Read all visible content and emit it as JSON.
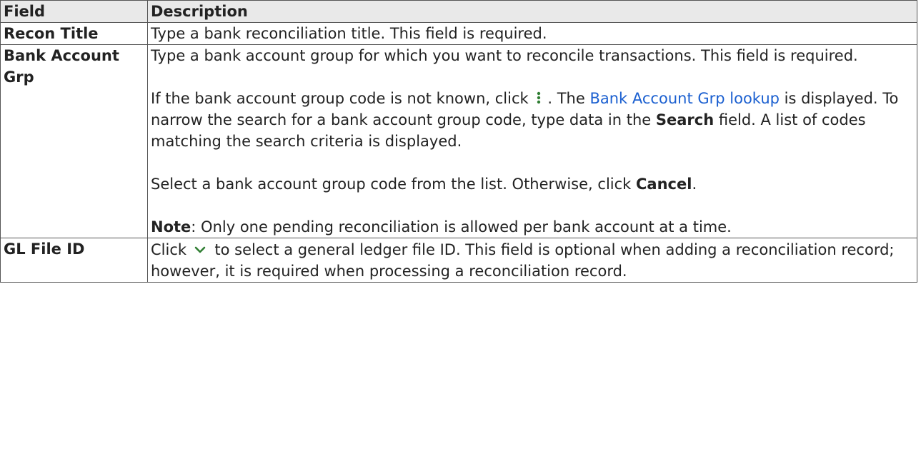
{
  "table": {
    "headers": [
      "Field",
      "Description"
    ],
    "rows": [
      {
        "field": "Recon Title",
        "desc": "Type a bank reconciliation title. This field is required."
      },
      {
        "field": "Bank Account Grp",
        "p1": "Type a bank account group for which you want to reconcile transactions. This field is required.",
        "p2_a": "If the bank account group code is not known, click",
        "p2_b": ". The",
        "p2_link": "Bank Account Grp lookup",
        "p2_c": "is displayed. To narrow the search for a bank account group code, type data in the",
        "p2_bold": "Search",
        "p2_d": "field. A list of codes matching the search criteria is displayed.",
        "p3_a": "Select a bank account group code from the list. Otherwise, click",
        "p3_bold": "Cancel",
        "p3_b": ".",
        "p4_bold": "Note",
        "p4_a": ": Only one pending reconciliation is allowed per bank account at a time."
      },
      {
        "field": "GL File ID",
        "desc_a": "Click",
        "desc_b": "to select a general ledger file ID. This field is optional when adding a reconciliation record; however, it is required when processing a reconciliation record."
      }
    ]
  },
  "icons": {
    "lookup": "kebab-vertical-icon",
    "dropdown": "chevron-down-icon"
  },
  "colors": {
    "link": "#1a5fd0",
    "icon": "#2f7d32",
    "header_bg": "#e9e9e9"
  }
}
